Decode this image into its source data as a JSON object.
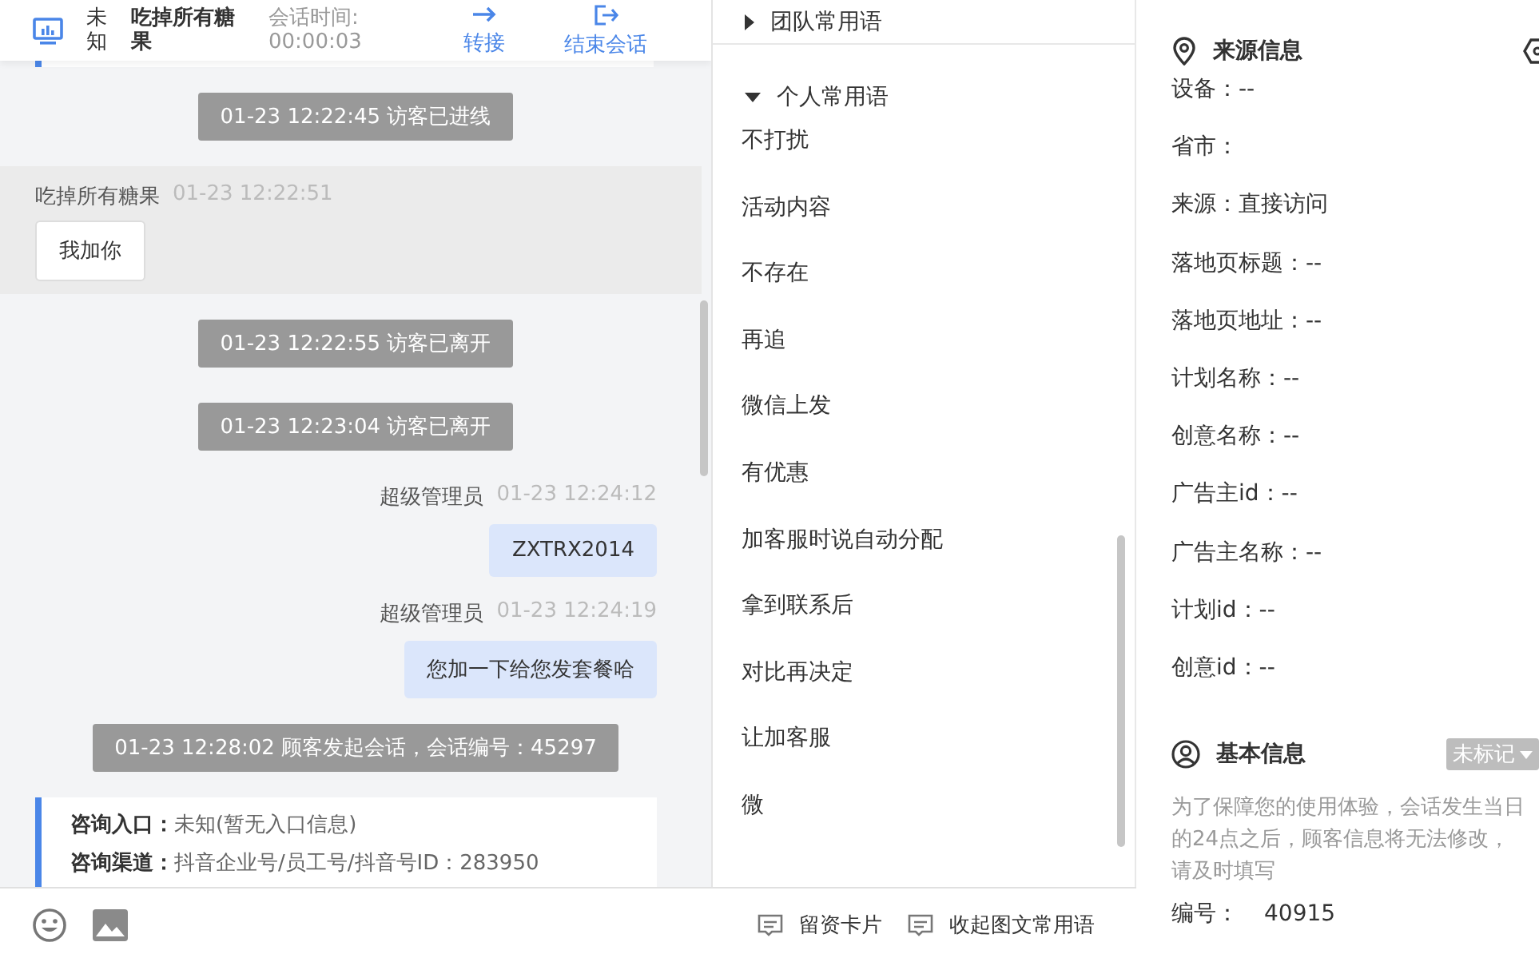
{
  "header": {
    "device_label": "未知",
    "visitor_name": "吃掉所有糖果",
    "duration_label": "会话时间:",
    "duration": "00:00:03",
    "actions": [
      {
        "kind": "transfer",
        "label": "转接"
      },
      {
        "kind": "end",
        "label": "结束会话"
      }
    ]
  },
  "messages": [
    {
      "kind": "system",
      "text": "01-23 12:22:45 访客已进线"
    },
    {
      "kind": "visitor",
      "sender": "吃掉所有糖果",
      "time": "01-23 12:22:51",
      "text": "我加你"
    },
    {
      "kind": "system",
      "text": "01-23 12:22:55 访客已离开"
    },
    {
      "kind": "system",
      "text": "01-23 12:23:04 访客已离开"
    },
    {
      "kind": "agent",
      "sender": "超级管理员",
      "time": "01-23 12:24:12",
      "text": "ZXTRX2014"
    },
    {
      "kind": "agent",
      "sender": "超级管理员",
      "time": "01-23 12:24:19",
      "text": "您加一下给您发套餐哈"
    },
    {
      "kind": "system",
      "text": "01-23 12:28:02 顾客发起会话，会话编号：45297"
    },
    {
      "kind": "info",
      "fields": [
        {
          "label": "咨询入口：",
          "value": "未知(暂无入口信息)"
        },
        {
          "label": "咨询渠道：",
          "value": "抖音企业号/员工号/抖音号ID：283950"
        }
      ]
    }
  ],
  "phrases": {
    "groups": [
      {
        "title": "团队常用语",
        "expanded": false
      },
      {
        "title": "个人常用语",
        "expanded": true,
        "items": [
          "不打扰",
          "活动内容",
          "不存在",
          "再追",
          "微信上发",
          "有优惠",
          "加客服时说自动分配",
          "拿到联系后",
          "对比再决定",
          "让加客服",
          "微"
        ]
      }
    ]
  },
  "bottom_actions": [
    "留资卡片",
    "收起图文常用语"
  ],
  "source_info": {
    "title": "来源信息",
    "fields": [
      "设备：--",
      "省市：",
      "来源：直接访问",
      "落地页标题：--",
      "落地页地址：--",
      "计划名称：--",
      "创意名称：--",
      "广告主id：--",
      "广告主名称：--",
      "计划id：--",
      "创意id：--"
    ]
  },
  "basic_info": {
    "title": "基本信息",
    "tag": "未标记",
    "notice": "为了保障您的使用体验，会话发生当日的24点之后，顾客信息将无法修改，请及时填写",
    "fields": [
      {
        "label": "编号：",
        "value": "40915"
      }
    ]
  }
}
